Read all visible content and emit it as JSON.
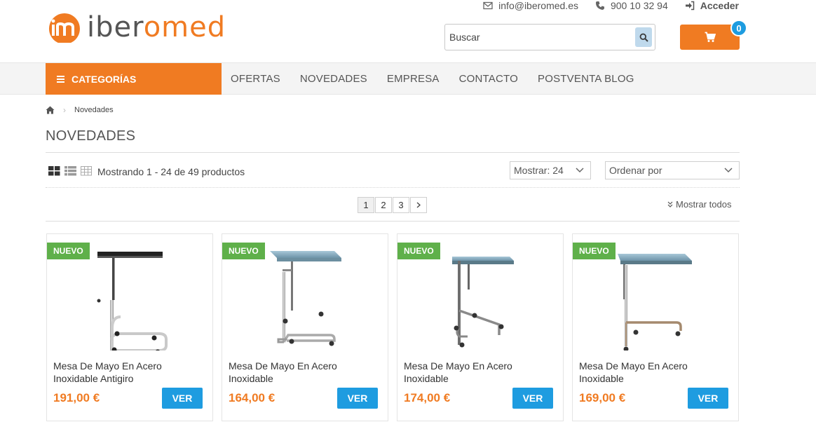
{
  "brand": {
    "name_prefix": "iber",
    "name_o": "o",
    "name_m": "m",
    "name_suffix": "ed",
    "accent": "#f07b22",
    "link_blue": "#1e9ce0",
    "badge_green": "#5fb04a"
  },
  "topbar": {
    "email": "info@iberomed.es",
    "email_icon": "envelope-icon",
    "phone": "900 10 32 94",
    "phone_icon": "phone-icon",
    "login": "Acceder",
    "login_icon": "sign-in-icon"
  },
  "search": {
    "placeholder": "Buscar",
    "value": "",
    "icon": "search-icon"
  },
  "cart": {
    "count": "0",
    "icon": "cart-icon"
  },
  "nav": {
    "categories_label": "CATEGORÍAS",
    "links": [
      "OFERTAS",
      "NOVEDADES",
      "EMPRESA",
      "CONTACTO",
      "POSTVENTA BLOG"
    ]
  },
  "breadcrumb": {
    "home_icon": "home-icon",
    "current": "Novedades"
  },
  "page": {
    "title": "NOVEDADES"
  },
  "toolbar": {
    "view_icons": [
      "grid-icon",
      "list-icon",
      "table-icon"
    ],
    "count_text": "Mostrando 1 - 24 de 49 productos",
    "per_page": "Mostrar: 24",
    "sort": "Ordenar por"
  },
  "pagination": {
    "pages": [
      "1",
      "2",
      "3"
    ],
    "current": "1",
    "next_icon": "chevron-right-icon",
    "show_all": "Mostrar todos"
  },
  "products": [
    {
      "badge": "NUEVO",
      "name": "Mesa De Mayo En Acero Inoxidable Antigiro",
      "price": "191,00 €",
      "button": "VER"
    },
    {
      "badge": "NUEVO",
      "name": "Mesa De Mayo En Acero Inoxidable",
      "price": "164,00 €",
      "button": "VER"
    },
    {
      "badge": "NUEVO",
      "name": "Mesa De Mayo En Acero Inoxidable",
      "price": "174,00 €",
      "button": "VER"
    },
    {
      "badge": "NUEVO",
      "name": "Mesa De Mayo En Acero Inoxidable",
      "price": "169,00 €",
      "button": "VER"
    }
  ]
}
